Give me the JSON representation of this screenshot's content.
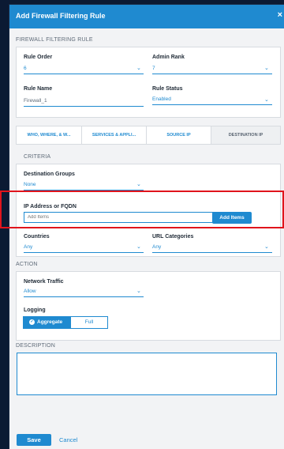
{
  "header": {
    "title": "Add Firewall Filtering Rule",
    "close": "×"
  },
  "sections": {
    "rule": "FIREWALL FILTERING RULE",
    "criteria": "CRITERIA",
    "action": "ACTION",
    "description": "DESCRIPTION"
  },
  "rule": {
    "rule_order_label": "Rule Order",
    "rule_order_value": "6",
    "admin_rank_label": "Admin Rank",
    "admin_rank_value": "7",
    "rule_name_label": "Rule Name",
    "rule_name_value": "Firewall_1",
    "rule_status_label": "Rule Status",
    "rule_status_value": "Enabled"
  },
  "tabs": [
    {
      "label": "WHO, WHERE, & W..."
    },
    {
      "label": "SERVICES & APPLI..."
    },
    {
      "label": "SOURCE IP"
    },
    {
      "label": "DESTINATION IP"
    }
  ],
  "criteria": {
    "dest_groups_label": "Destination Groups",
    "dest_groups_value": "None",
    "ip_label": "IP Address or FQDN",
    "ip_placeholder": "Add Items",
    "add_items_button": "Add Items",
    "countries_label": "Countries",
    "countries_value": "Any",
    "url_categories_label": "URL Categories",
    "url_categories_value": "Any"
  },
  "action": {
    "network_traffic_label": "Network Traffic",
    "network_traffic_value": "Allow",
    "logging_label": "Logging",
    "logging_options": [
      "Aggregate",
      "Full"
    ]
  },
  "footer": {
    "save": "Save",
    "cancel": "Cancel"
  },
  "colors": {
    "accent": "#1f8ad0",
    "highlight": "#e0141c"
  }
}
